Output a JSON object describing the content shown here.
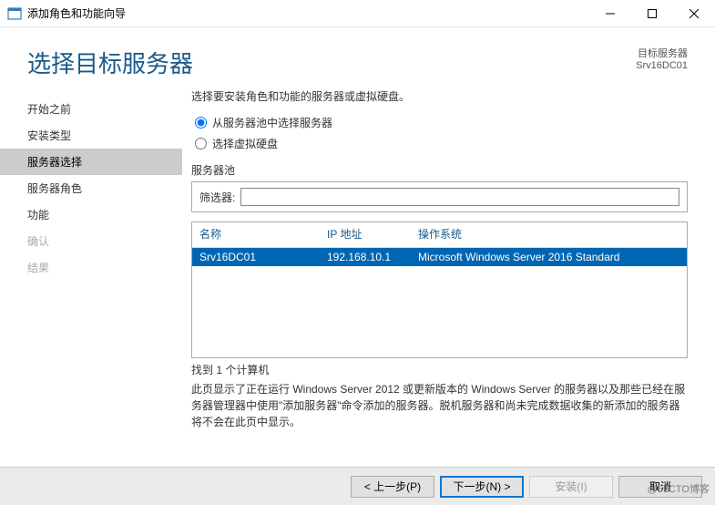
{
  "window": {
    "title": "添加角色和功能向导"
  },
  "header": {
    "title": "选择目标服务器",
    "target_label": "目标服务器",
    "target_value": "Srv16DC01"
  },
  "sidebar": {
    "items": [
      {
        "label": "开始之前",
        "state": "normal"
      },
      {
        "label": "安装类型",
        "state": "normal"
      },
      {
        "label": "服务器选择",
        "state": "active"
      },
      {
        "label": "服务器角色",
        "state": "normal"
      },
      {
        "label": "功能",
        "state": "normal"
      },
      {
        "label": "确认",
        "state": "disabled"
      },
      {
        "label": "结果",
        "state": "disabled"
      }
    ]
  },
  "content": {
    "instruction": "选择要安装角色和功能的服务器或虚拟硬盘。",
    "radio1": "从服务器池中选择服务器",
    "radio2": "选择虚拟硬盘",
    "pool_label": "服务器池",
    "filter_label": "筛选器:",
    "filter_value": "",
    "columns": {
      "name": "名称",
      "ip": "IP 地址",
      "os": "操作系统"
    },
    "rows": [
      {
        "name": "Srv16DC01",
        "ip": "192.168.10.1",
        "os": "Microsoft Windows Server 2016 Standard"
      }
    ],
    "found": "找到 1 个计算机",
    "footnote": "此页显示了正在运行 Windows Server 2012 或更新版本的 Windows Server 的服务器以及那些已经在服务器管理器中使用\"添加服务器\"命令添加的服务器。脱机服务器和尚未完成数据收集的新添加的服务器将不会在此页中显示。"
  },
  "footer": {
    "prev": "< 上一步(P)",
    "next": "下一步(N) >",
    "install": "安装(I)",
    "cancel": "取消"
  },
  "watermark": "@51CTO博客"
}
